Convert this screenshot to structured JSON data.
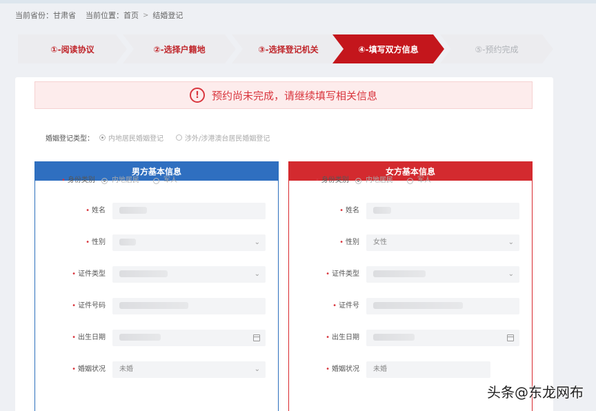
{
  "breadcrumb": {
    "province_label": "当前省份：",
    "province": "甘肃省",
    "location_label": "当前位置：",
    "home": "首页",
    "separator": ">",
    "current": "结婚登记"
  },
  "steps": [
    {
      "label": "①-阅读协议",
      "state": "done"
    },
    {
      "label": "②-选择户籍地",
      "state": "done"
    },
    {
      "label": "③-选择登记机关",
      "state": "done"
    },
    {
      "label": "④-填写双方信息",
      "state": "active"
    },
    {
      "label": "⑤-预约完成",
      "state": "future"
    }
  ],
  "alert": {
    "icon": "exclamation-icon",
    "icon_glyph": "!",
    "message": "预约尚未完成，请继续填写相关信息"
  },
  "registration_type": {
    "label": "婚姻登记类型：",
    "options": [
      "内地居民婚姻登记",
      "涉外/涉港澳台居民婚姻登记"
    ],
    "selected": 0
  },
  "male_panel": {
    "title": "男方基本信息",
    "identity_label": "身份类别",
    "identity_options": [
      "内地居民",
      "军人"
    ],
    "fields": {
      "name": {
        "label": "姓名",
        "value": ""
      },
      "gender": {
        "label": "性别",
        "value": ""
      },
      "id_type": {
        "label": "证件类型",
        "value": ""
      },
      "id_number": {
        "label": "证件号码",
        "value": ""
      },
      "birth_date": {
        "label": "出生日期",
        "value": ""
      },
      "marital_status": {
        "label": "婚姻状况",
        "value": "未婚"
      }
    }
  },
  "female_panel": {
    "title": "女方基本信息",
    "identity_label": "身份类别",
    "identity_options": [
      "内地居民",
      "军人"
    ],
    "fields": {
      "name": {
        "label": "姓名",
        "value": ""
      },
      "gender": {
        "label": "性别",
        "value": "女性"
      },
      "id_type": {
        "label": "证件类型",
        "value": ""
      },
      "id_number": {
        "label": "证件号",
        "value": ""
      },
      "birth_date": {
        "label": "出生日期",
        "value": ""
      },
      "marital_status": {
        "label": "婚姻状况",
        "value": "未婚"
      }
    }
  },
  "watermark": "头条@东龙网布",
  "colors": {
    "brand_red": "#c4161c",
    "male_blue": "#2f6fc0",
    "female_red": "#d32a2f",
    "alert_bg": "#fdecec"
  }
}
